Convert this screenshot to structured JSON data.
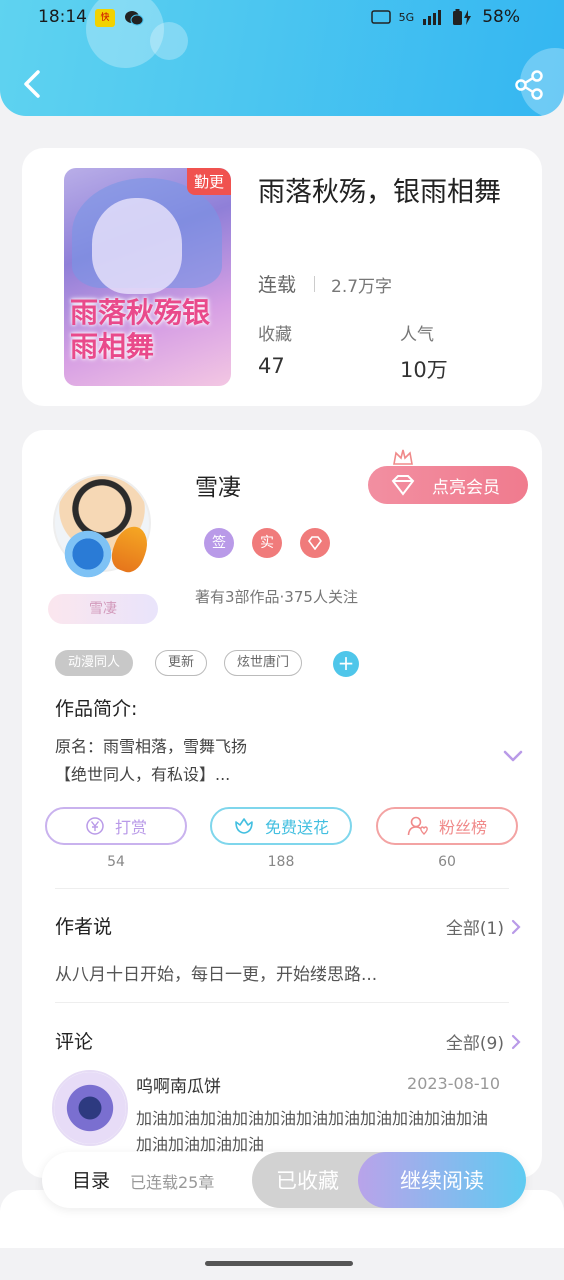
{
  "status_bar": {
    "time": "18:14",
    "network": "5G",
    "battery": "58%"
  },
  "book": {
    "cover_badge": "勤更",
    "cover_title": "雨落秋殇银雨相舞",
    "title": "雨落秋殇，银雨相舞",
    "status": "连载",
    "words": "2.7万字",
    "collect_label": "收藏",
    "collect_value": "47",
    "popularity_label": "人气",
    "popularity_value": "10万"
  },
  "author": {
    "name": "雪凄",
    "name_plate": "雪凄",
    "vip_label": "点亮会员",
    "badges": [
      {
        "label": "签",
        "color": "#b99ae8"
      },
      {
        "label": "实",
        "color": "#f07b7b"
      },
      {
        "label": "",
        "color": "#f07b7b"
      }
    ],
    "meta": "著有3部作品·375人关注"
  },
  "tags": [
    "动漫同人",
    "更新",
    "炫世唐门"
  ],
  "intro": {
    "heading": "作品简介:",
    "line1": "原名：雨雪相落，雪舞飞扬",
    "line2": "【绝世同人，有私设】..."
  },
  "actions": [
    {
      "label": "打赏",
      "count": "54",
      "color": "#b99ae8"
    },
    {
      "label": "免费送花",
      "count": "188",
      "color": "#5fcbe8"
    },
    {
      "label": "粉丝榜",
      "count": "60",
      "color": "#f08a8a"
    }
  ],
  "author_says": {
    "heading": "作者说",
    "all_label": "全部(1)",
    "text": "从八月十日开始，每日一更，开始缕思路..."
  },
  "comments": {
    "heading": "评论",
    "all_label": "全部(9)",
    "user": "呜啊南瓜饼",
    "date": "2023-08-10",
    "text": "加油加油加油加油加油加油加油加油加油加油加油加油加油加油加油"
  },
  "bottom_bar": {
    "toc_label": "目录",
    "toc_count": "已连载25章",
    "collected_label": "已收藏",
    "read_label": "继续阅读"
  }
}
